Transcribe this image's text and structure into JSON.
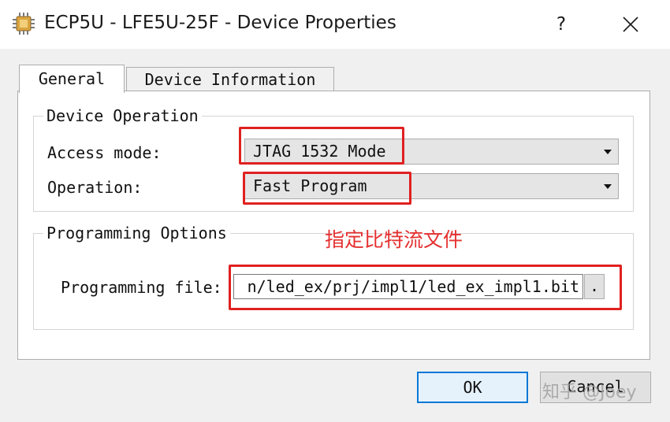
{
  "window": {
    "title": "ECP5U - LFE5U-25F - Device Properties",
    "help_label": "?",
    "app_icon": "chip-icon",
    "close_icon": "close-icon"
  },
  "tabs": [
    {
      "label": "General",
      "active": true
    },
    {
      "label": "Device Information",
      "active": false
    }
  ],
  "device_operation": {
    "title": "Device Operation",
    "access_mode_label": "Access mode:",
    "access_mode_value": "JTAG 1532 Mode",
    "operation_label": "Operation:",
    "operation_value": "Fast Program"
  },
  "programming_options": {
    "title": "Programming Options",
    "file_label": "Programming file:",
    "file_value": "n/led_ex/prj/impl1/led_ex_impl1.bit",
    "browse_label": "."
  },
  "annotation": {
    "text": "指定比特流文件",
    "color": "#e53030"
  },
  "buttons": {
    "ok": "OK",
    "cancel": "Cancel"
  },
  "watermark": "知乎 @Joey",
  "colors": {
    "highlight": "#e02020",
    "ok_border": "#0078d7"
  }
}
